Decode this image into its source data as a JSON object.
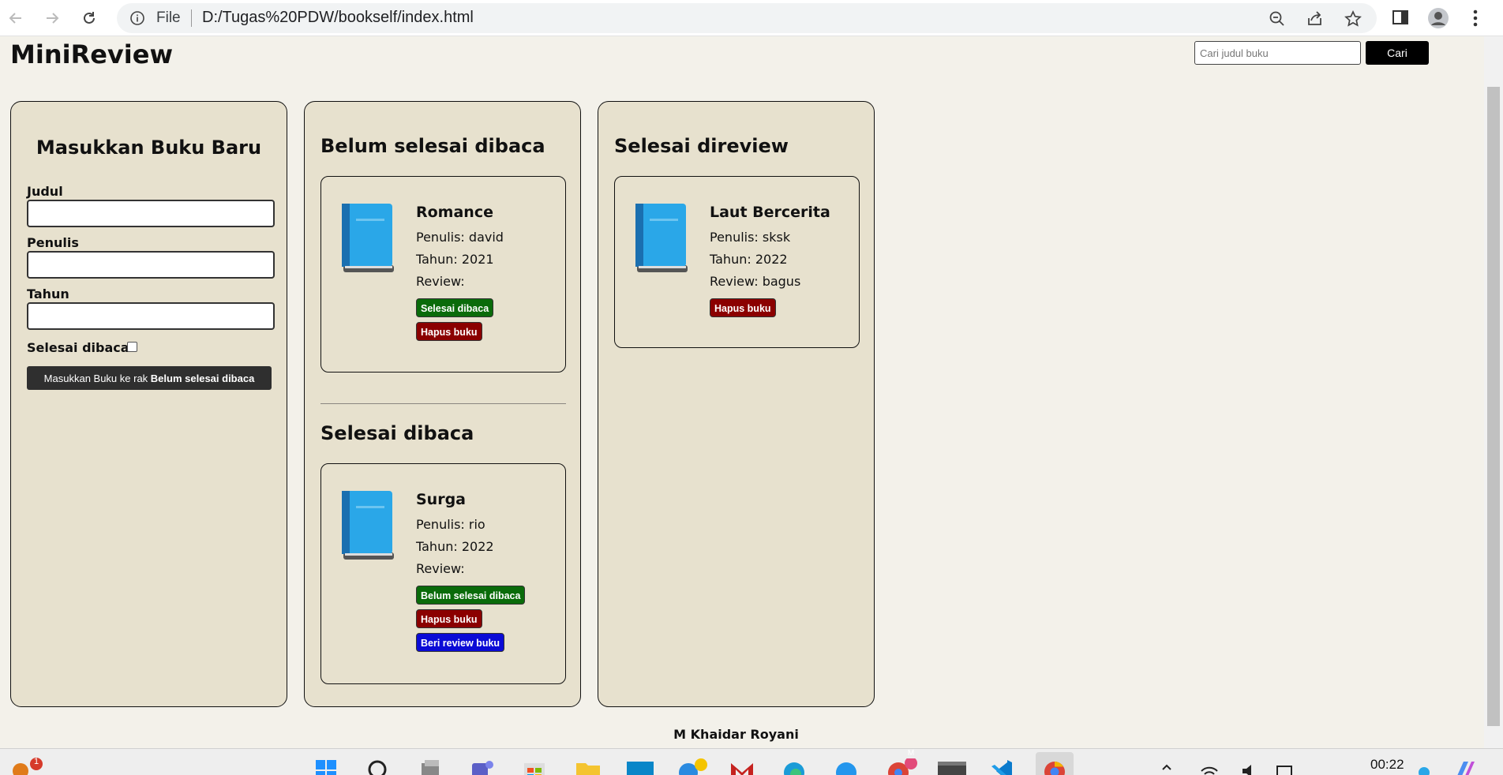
{
  "browser": {
    "scheme_label": "File",
    "url": "D:/Tugas%20PDW/bookself/index.html"
  },
  "header": {
    "brand": "MiniReview",
    "search_placeholder": "Cari judul buku",
    "search_button": "Cari"
  },
  "form": {
    "title": "Masukkan Buku Baru",
    "title_label": "Judul",
    "author_label": "Penulis",
    "year_label": "Tahun",
    "done_label": "Selesai dibaca",
    "submit_prefix": "Masukkan Buku ke rak ",
    "submit_target": "Belum selesai dibaca"
  },
  "shelves": {
    "unfinished": {
      "title": "Belum selesai dibaca",
      "books": [
        {
          "title": "Romance",
          "author": "Penulis: david",
          "year": "Tahun: 2021",
          "review": "Review:",
          "actions": [
            "Selesai dibaca",
            "Hapus buku"
          ]
        }
      ]
    },
    "finished": {
      "title": "Selesai dibaca",
      "books": [
        {
          "title": "Surga",
          "author": "Penulis: rio",
          "year": "Tahun: 2022",
          "review": "Review:",
          "actions": [
            "Belum selesai dibaca",
            "Hapus buku",
            "Beri review buku"
          ]
        }
      ]
    },
    "reviewed": {
      "title": "Selesai direview",
      "books": [
        {
          "title": "Laut Bercerita",
          "author": "Penulis: sksk",
          "year": "Tahun: 2022",
          "review": "Review: bagus",
          "actions": [
            "Hapus buku"
          ]
        }
      ]
    }
  },
  "footer": {
    "credit": "M Khaidar Royani"
  },
  "taskbar": {
    "time": "00:22",
    "notification_count": "1",
    "chrome_badge": "M"
  },
  "colors": {
    "page_bg": "#f3f1ea",
    "panel_bg": "#e7e1ce",
    "green": "#0a6b0a",
    "red": "#8b0000",
    "blue": "#0b0bd6"
  }
}
